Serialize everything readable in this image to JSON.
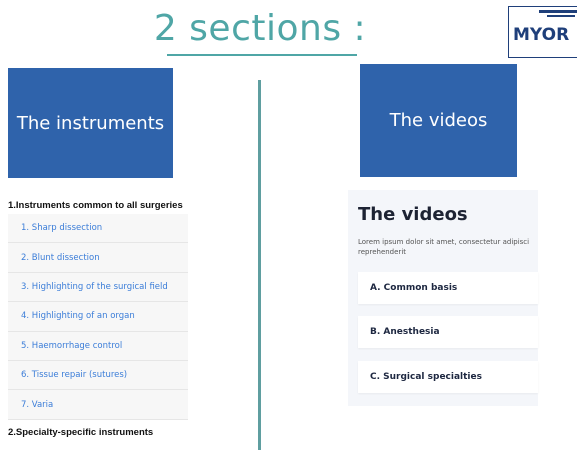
{
  "title": "2 sections :",
  "logo": {
    "text": "MYOR"
  },
  "instruments": {
    "card_label": "The instruments",
    "section1_heading": "1.Instruments common to all surgeries",
    "items": [
      "1. Sharp dissection",
      "2. Blunt dissection",
      "3. Highlighting of the surgical field",
      "4. Highlighting of an organ",
      "5. Haemorrhage control",
      "6. Tissue repair (sutures)",
      "7. Varia"
    ],
    "section2_heading": "2.Specialty-specific instruments"
  },
  "videos": {
    "card_label": "The videos",
    "panel_title": "The videos",
    "description": "Lorem ipsum dolor sit amet, consectetur adipisci reprehenderit",
    "items": [
      "A. Common basis",
      "B. Anesthesia",
      "C. Surgical specialties"
    ]
  }
}
